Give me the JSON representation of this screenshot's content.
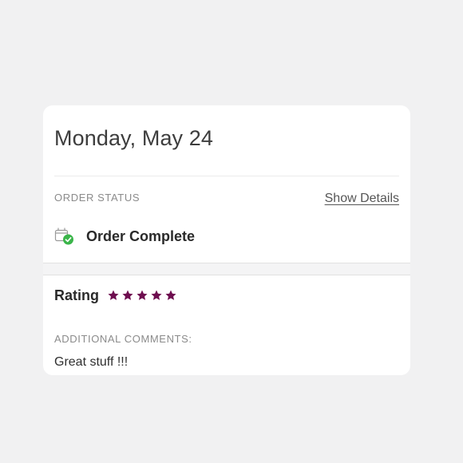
{
  "order": {
    "date": "Monday, May 24",
    "status_label": "ORDER STATUS",
    "show_details_label": "Show Details",
    "status_icon": "order-complete-icon",
    "status_text": "Order Complete"
  },
  "rating": {
    "label": "Rating",
    "value": 5,
    "max": 5,
    "star_color": "#6e0d4f"
  },
  "comments": {
    "label": "ADDITIONAL COMMENTS:",
    "text": "Great stuff !!!"
  },
  "colors": {
    "success": "#3bb54a",
    "star": "#6e0d4f"
  }
}
